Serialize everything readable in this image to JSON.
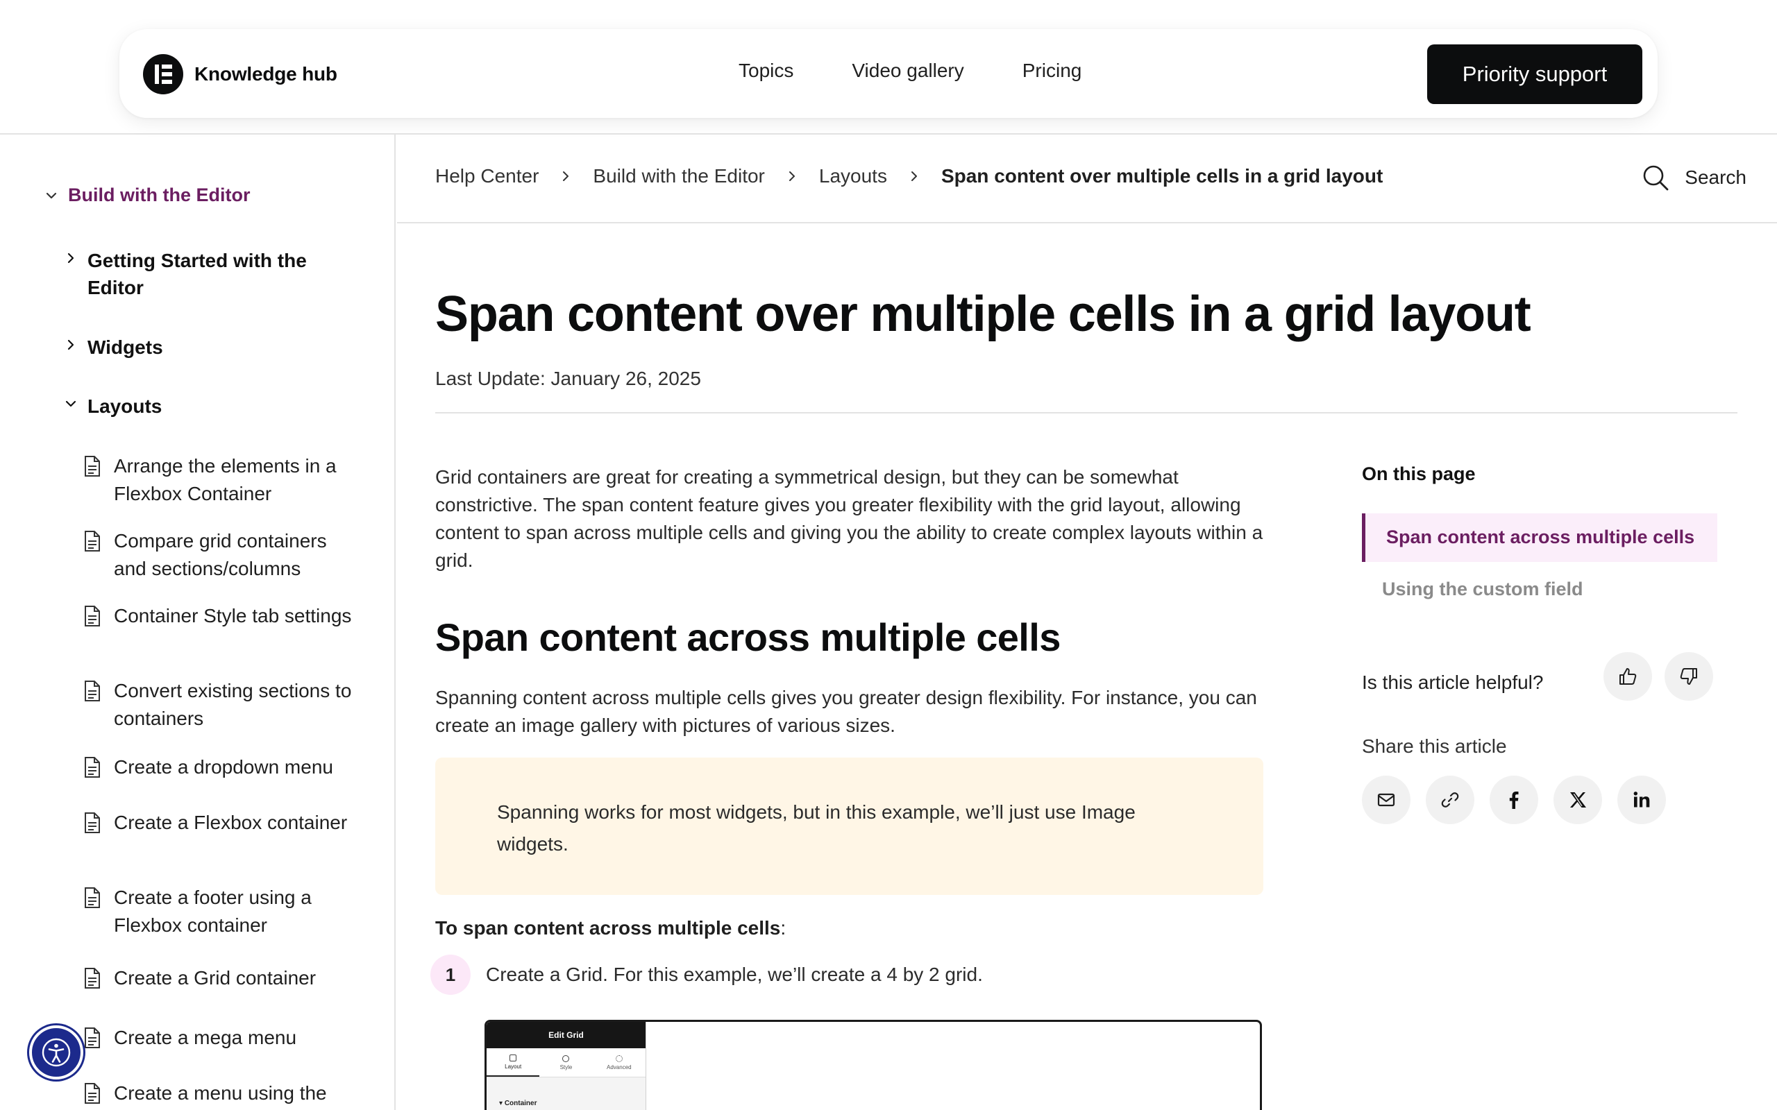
{
  "header": {
    "brand": "Knowledge hub",
    "nav": [
      "Topics",
      "Video gallery",
      "Pricing"
    ],
    "cta": "Priority support"
  },
  "sidebar": {
    "root": "Build with the Editor",
    "groups": [
      "Getting Started with the Editor",
      "Widgets",
      "Layouts"
    ],
    "items": [
      "Arrange the elements in a Flexbox Container",
      "Compare grid containers and sections/columns",
      "Container Style tab settings",
      "Convert existing sections to containers",
      "Create a dropdown menu",
      "Create a Flexbox container",
      "Create a footer using a Flexbox container",
      "Create a Grid container",
      "Create a mega menu",
      "Create a menu using the"
    ]
  },
  "breadcrumb": {
    "items": [
      "Help Center",
      "Build with the Editor",
      "Layouts"
    ],
    "current": "Span content over multiple cells in a grid layout"
  },
  "search": {
    "label": "Search"
  },
  "article": {
    "title": "Span content over multiple cells in a grid layout",
    "last_update": "Last Update: January 26, 2025",
    "intro": "Grid containers are great for creating a symmetrical design, but they can be somewhat constrictive. The span content feature gives you greater flexibility with the grid layout, allowing content to span across multiple cells and giving you the ability to create complex layouts within a grid.",
    "section_heading": "Span content across multiple cells",
    "section_text": "Spanning content across multiple cells gives you greater design flexibility. For instance, you can create an image gallery with pictures of various sizes.",
    "note": "Spanning works for most widgets, but in this example, we’ll just use Image widgets.",
    "steps_heading": "To span content across multiple cells",
    "steps_heading_suffix": ":",
    "steps": [
      {
        "num": "1",
        "text": "Create a Grid. For this example, we’ll create a 4 by 2 grid."
      }
    ],
    "screenshot": {
      "panel_title": "Edit Grid",
      "tabs": [
        "Layout",
        "Style",
        "Advanced"
      ],
      "section": "Container"
    }
  },
  "toc": {
    "title": "On this page",
    "items": [
      "Span content across multiple cells",
      "Using the custom field"
    ],
    "active_index": 0
  },
  "feedback": {
    "question": "Is this article helpful?"
  },
  "share": {
    "label": "Share this article",
    "icons": [
      "mail-icon",
      "link-icon",
      "facebook-icon",
      "x-icon",
      "linkedin-icon"
    ]
  },
  "colors": {
    "accent": "#6b1e61",
    "toc_active_bg": "#fbeefa",
    "note_bg": "#fff6e6",
    "step_badge_bg": "#fce8f8",
    "accessibility_button": "#1c2a8c",
    "cta_bg": "#0c0d0e"
  }
}
